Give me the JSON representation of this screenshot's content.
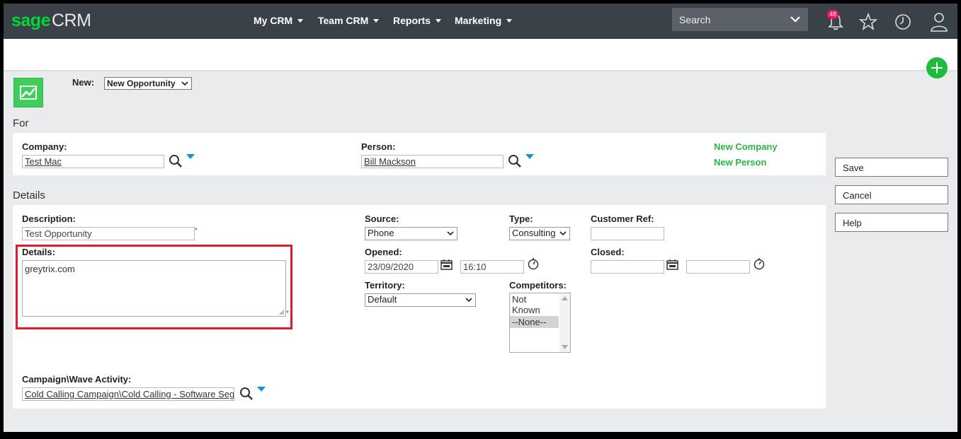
{
  "app": {
    "logo_sage": "sage",
    "logo_crm": "CRM"
  },
  "nav": [
    {
      "label": "My CRM"
    },
    {
      "label": "Team CRM"
    },
    {
      "label": "Reports"
    },
    {
      "label": "Marketing"
    }
  ],
  "search": {
    "placeholder": "Search"
  },
  "notifications": {
    "count": "48"
  },
  "new_bar": {
    "label": "New:",
    "selected": "New Opportunity"
  },
  "for_section": {
    "title": "For",
    "company_label": "Company:",
    "company_value": "Test Mac",
    "person_label": "Person:",
    "person_value": "Bill Mackson",
    "new_company": "New Company",
    "new_person": "New Person"
  },
  "details_section": {
    "title": "Details",
    "description_label": "Description:",
    "description_value": "Test Opportunity",
    "details_label": "Details:",
    "details_value": "greytrix.com",
    "source_label": "Source:",
    "source_value": "Phone",
    "type_label": "Type:",
    "type_value": "Consulting",
    "customer_ref_label": "Customer Ref:",
    "customer_ref_value": "",
    "opened_label": "Opened:",
    "opened_date": "23/09/2020",
    "opened_time": "16:10",
    "closed_label": "Closed:",
    "closed_date": "",
    "closed_time": "",
    "territory_label": "Territory:",
    "territory_value": "Default",
    "competitors_label": "Competitors:",
    "competitors_options": [
      "Not Known",
      "--None--"
    ],
    "campaign_label": "Campaign\\Wave Activity:",
    "campaign_value": "Cold Calling Campaign\\Cold Calling - Software Seg",
    "required_mark": "*"
  },
  "actions": {
    "save": "Save",
    "cancel": "Cancel",
    "help": "Help"
  },
  "colors": {
    "topbar": "#3a4149",
    "brand_green": "#00d639",
    "link_green": "#2db34a",
    "highlight_red": "#e01b2a",
    "dropdown_blue": "#1591d3"
  }
}
